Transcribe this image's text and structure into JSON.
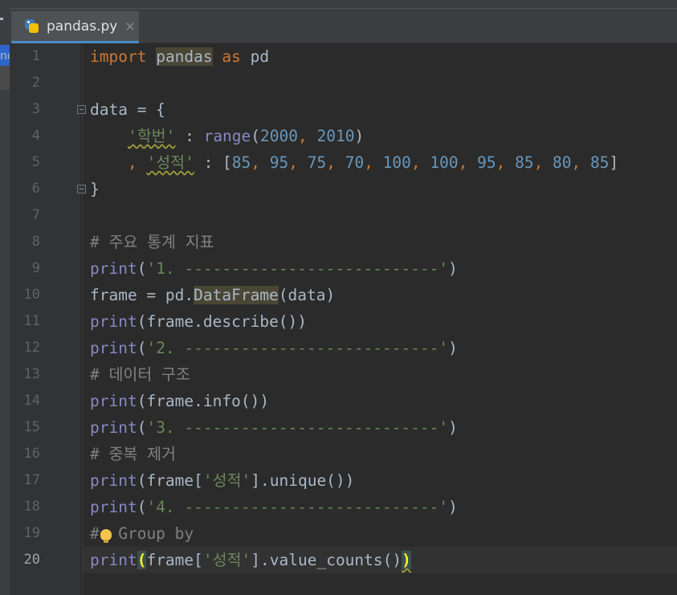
{
  "tab": {
    "filename": "pandas.py",
    "close_glyph": "×"
  },
  "sidebar": {
    "visible_fragment": "nc"
  },
  "gutter": {
    "line_numbers": [
      "1",
      "2",
      "3",
      "4",
      "5",
      "6",
      "7",
      "8",
      "9",
      "10",
      "11",
      "12",
      "13",
      "14",
      "15",
      "16",
      "17",
      "18",
      "19",
      "20"
    ],
    "current_line": "20"
  },
  "code": {
    "l1_import": "import",
    "l1_pandas": "pandas",
    "l1_as": "as",
    "l1_pd": "pd",
    "l3": "data = {",
    "l4_key": "'학번'",
    "l4_colon": " : ",
    "l4_range": "range",
    "l4_open": "(",
    "l4_n1": "2000",
    "l4_comma": ", ",
    "l4_n2": "2010",
    "l4_close": ")",
    "l5_lead": ", ",
    "l5_key": "'성적'",
    "l5_colon": " : [",
    "l5_values": [
      "85",
      "95",
      "75",
      "70",
      "100",
      "100",
      "95",
      "85",
      "80",
      "85"
    ],
    "l5_sep": ", ",
    "l5_end": "]",
    "l6": "}",
    "l8": "# 주요 통계 지표",
    "print": "print",
    "l9_str": "'1. ---------------------------'",
    "l10_a": "frame = pd.",
    "l10_df": "DataFrame",
    "l10_b": "(data)",
    "l11_rest": "(frame.describe())",
    "l12_str": "'2. ---------------------------'",
    "l13": "# 데이터 구조",
    "l14_rest": "(frame.info())",
    "l15_str": "'3. ---------------------------'",
    "l16": "# 중복 제거",
    "l17_a": "(frame[",
    "l17_key": "'성적'",
    "l17_b": "].unique())",
    "l18_str": "'4. ---------------------------'",
    "l19": "#  Group by",
    "l20_open": "(",
    "l20_a": "frame[",
    "l20_key": "'성적'",
    "l20_b": "].value_counts()",
    "l20_close": ")"
  }
}
